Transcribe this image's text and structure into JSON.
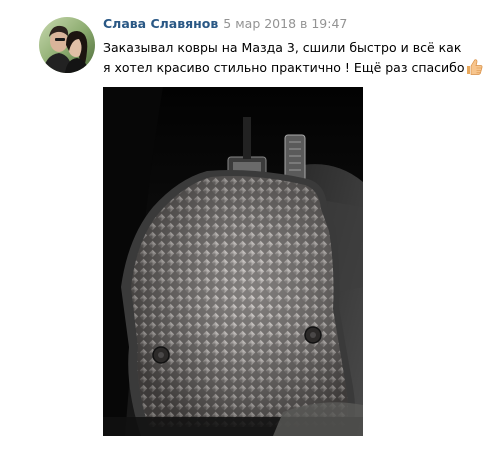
{
  "post": {
    "author": "Слава Славянов",
    "date": "5 мар 2018 в 19:47",
    "text_line1": "Заказывал ковры на Мазда 3, сшили быстро и всё как",
    "text_line2": "я хотел красиво стильно практично ! Ещё раз спасибо",
    "emoji": "thumbs-up-icon",
    "photo": "car-floor-mat-photo"
  },
  "colors": {
    "author": "#2a5885",
    "date": "#939393",
    "text": "#000000"
  }
}
